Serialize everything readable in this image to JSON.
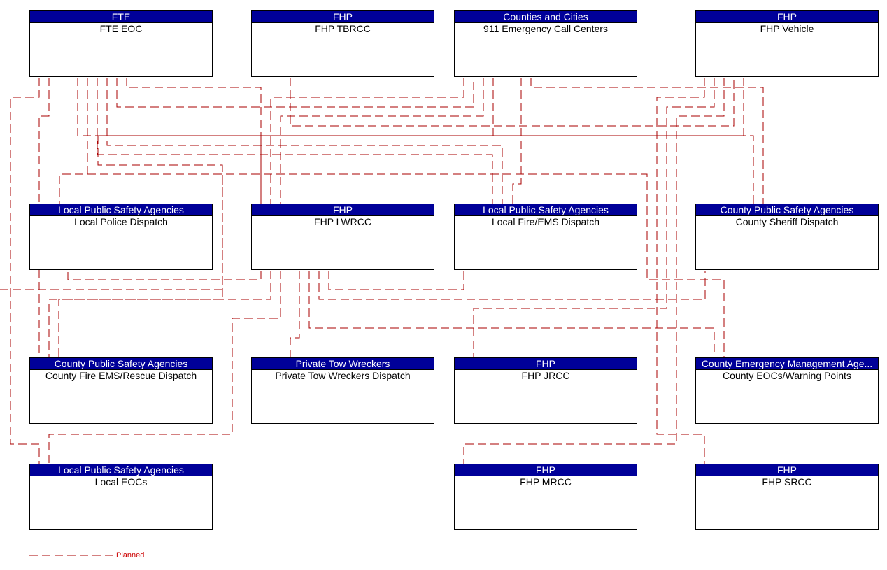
{
  "diagram": {
    "line_color": "#aa0000",
    "header_color": "#000099",
    "nodes": [
      {
        "id": "fte-eoc",
        "owner": "FTE",
        "name": "FTE EOC"
      },
      {
        "id": "fhp-tbrcc",
        "owner": "FHP",
        "name": "FHP TBRCC"
      },
      {
        "id": "911-centers",
        "owner": "Counties and Cities",
        "name": "911 Emergency Call Centers"
      },
      {
        "id": "fhp-vehicle",
        "owner": "FHP",
        "name": "FHP Vehicle"
      },
      {
        "id": "local-police",
        "owner": "Local Public Safety Agencies",
        "name": "Local Police Dispatch"
      },
      {
        "id": "fhp-lwrcc",
        "owner": "FHP",
        "name": "FHP LWRCC"
      },
      {
        "id": "local-fire",
        "owner": "Local Public Safety Agencies",
        "name": "Local Fire/EMS Dispatch"
      },
      {
        "id": "county-sheriff",
        "owner": "County Public Safety Agencies",
        "name": "County Sheriff Dispatch"
      },
      {
        "id": "county-fire",
        "owner": "County Public Safety Agencies",
        "name": "County Fire EMS/Rescue Dispatch"
      },
      {
        "id": "tow-wreckers",
        "owner": "Private Tow Wreckers",
        "name": "Private Tow Wreckers Dispatch"
      },
      {
        "id": "fhp-jrcc",
        "owner": "FHP",
        "name": "FHP JRCC"
      },
      {
        "id": "county-eocs",
        "owner": "County Emergency Management Age...",
        "name": "County EOCs/Warning Points"
      },
      {
        "id": "local-eocs",
        "owner": "Local Public Safety Agencies",
        "name": "Local EOCs"
      },
      {
        "id": "fhp-mrcc",
        "owner": "FHP",
        "name": "FHP MRCC"
      },
      {
        "id": "fhp-srcc",
        "owner": "FHP",
        "name": "FHP SRCC"
      }
    ],
    "connections": [
      {
        "from": "fte-eoc",
        "to": "local-eocs",
        "status": "Planned"
      },
      {
        "from": "fte-eoc",
        "to": "county-fire",
        "status": "Planned"
      },
      {
        "from": "fte-eoc",
        "to": "local-police",
        "status": "Planned"
      },
      {
        "from": "fte-eoc",
        "to": "fhp-lwrcc",
        "status": "Planned"
      },
      {
        "from": "fte-eoc",
        "to": "local-fire",
        "status": "Planned"
      },
      {
        "from": "fte-eoc",
        "to": "county-sheriff",
        "status": "Planned"
      },
      {
        "from": "fte-eoc",
        "to": "county-eocs",
        "status": "Planned"
      },
      {
        "from": "fte-eoc",
        "to": "911-centers",
        "status": "Planned"
      },
      {
        "from": "fhp-tbrcc",
        "to": "fhp-vehicle",
        "status": "Planned"
      },
      {
        "from": "911-centers",
        "to": "fhp-lwrcc",
        "status": "Planned"
      },
      {
        "from": "911-centers",
        "to": "local-police",
        "status": "Planned"
      },
      {
        "from": "911-centers",
        "to": "local-fire",
        "status": "Planned"
      },
      {
        "from": "911-centers",
        "to": "county-fire",
        "status": "Planned"
      },
      {
        "from": "911-centers",
        "to": "county-sheriff",
        "status": "Planned"
      },
      {
        "from": "fhp-vehicle",
        "to": "fhp-lwrcc",
        "status": "Planned"
      },
      {
        "from": "fhp-vehicle",
        "to": "fhp-jrcc",
        "status": "Planned"
      },
      {
        "from": "fhp-vehicle",
        "to": "fhp-mrcc",
        "status": "Planned"
      },
      {
        "from": "fhp-vehicle",
        "to": "fhp-srcc",
        "status": "Planned"
      },
      {
        "from": "fhp-vehicle",
        "to": "local-fire",
        "status": "Planned"
      },
      {
        "from": "fhp-lwrcc",
        "to": "local-police",
        "status": "Planned"
      },
      {
        "from": "fhp-lwrcc",
        "to": "county-fire",
        "status": "Planned"
      },
      {
        "from": "fhp-lwrcc",
        "to": "local-eocs",
        "status": "Planned"
      },
      {
        "from": "fhp-lwrcc",
        "to": "tow-wreckers",
        "status": "Planned"
      },
      {
        "from": "fhp-lwrcc",
        "to": "local-fire",
        "status": "Planned"
      },
      {
        "from": "fhp-lwrcc",
        "to": "county-sheriff",
        "status": "Planned"
      },
      {
        "from": "fhp-lwrcc",
        "to": "county-eocs",
        "status": "Planned"
      }
    ]
  },
  "legend": {
    "items": [
      {
        "label": "Planned",
        "style": "dashed",
        "color": "#cc0000"
      }
    ]
  }
}
